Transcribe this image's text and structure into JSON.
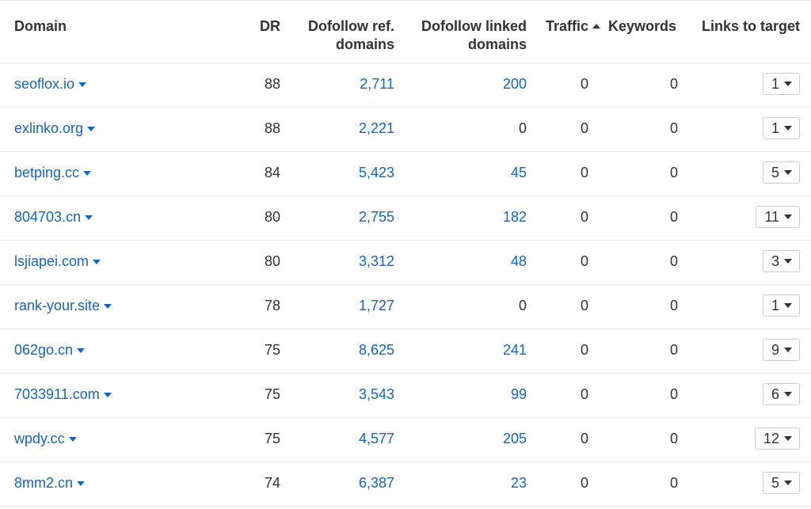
{
  "header": {
    "domain": "Domain",
    "dr": "DR",
    "ref_domains_line1": "Dofollow ref.",
    "ref_domains_line2": "domains",
    "linked_domains_line1": "Dofollow linked",
    "linked_domains_line2": "domains",
    "traffic": "Traffic",
    "traffic_sort_icon": "sort-ascending-icon",
    "keywords": "Keywords",
    "links_to_target": "Links to target"
  },
  "colors": {
    "link": "#1565c0",
    "text": "#333333",
    "divider": "#e6e6e6"
  },
  "rows": [
    {
      "domain": "seoflox.io",
      "dr": "88",
      "ref_domains": "2,711",
      "linked_domains": "200",
      "linked_is_link": true,
      "traffic": "0",
      "keywords": "0",
      "links": "1"
    },
    {
      "domain": "exlinko.org",
      "dr": "88",
      "ref_domains": "2,221",
      "linked_domains": "0",
      "linked_is_link": false,
      "traffic": "0",
      "keywords": "0",
      "links": "1"
    },
    {
      "domain": "betping.cc",
      "dr": "84",
      "ref_domains": "5,423",
      "linked_domains": "45",
      "linked_is_link": true,
      "traffic": "0",
      "keywords": "0",
      "links": "5"
    },
    {
      "domain": "804703.cn",
      "dr": "80",
      "ref_domains": "2,755",
      "linked_domains": "182",
      "linked_is_link": true,
      "traffic": "0",
      "keywords": "0",
      "links": "11"
    },
    {
      "domain": "lsjiapei.com",
      "dr": "80",
      "ref_domains": "3,312",
      "linked_domains": "48",
      "linked_is_link": true,
      "traffic": "0",
      "keywords": "0",
      "links": "3"
    },
    {
      "domain": "rank-your.site",
      "dr": "78",
      "ref_domains": "1,727",
      "linked_domains": "0",
      "linked_is_link": false,
      "traffic": "0",
      "keywords": "0",
      "links": "1"
    },
    {
      "domain": "062go.cn",
      "dr": "75",
      "ref_domains": "8,625",
      "linked_domains": "241",
      "linked_is_link": true,
      "traffic": "0",
      "keywords": "0",
      "links": "9"
    },
    {
      "domain": "7033911.com",
      "dr": "75",
      "ref_domains": "3,543",
      "linked_domains": "99",
      "linked_is_link": true,
      "traffic": "0",
      "keywords": "0",
      "links": "6"
    },
    {
      "domain": "wpdy.cc",
      "dr": "75",
      "ref_domains": "4,577",
      "linked_domains": "205",
      "linked_is_link": true,
      "traffic": "0",
      "keywords": "0",
      "links": "12"
    },
    {
      "domain": "8mm2.cn",
      "dr": "74",
      "ref_domains": "6,387",
      "linked_domains": "23",
      "linked_is_link": true,
      "traffic": "0",
      "keywords": "0",
      "links": "5"
    }
  ]
}
